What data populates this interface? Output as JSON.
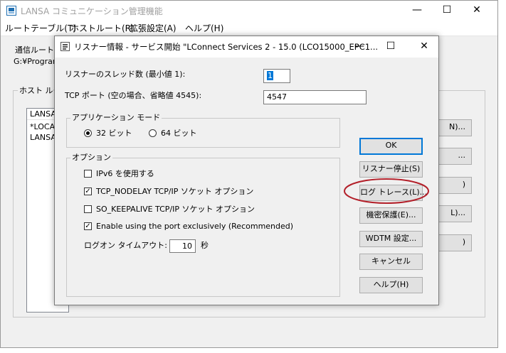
{
  "main_window": {
    "title": "LANSA コミュニケーション管理機能",
    "controls": {
      "minimize": "—",
      "maximize": "☐",
      "close": "✕"
    },
    "menu": [
      {
        "label": "ルートテーブル(T)"
      },
      {
        "label": "ホストルート(R)"
      },
      {
        "label": "拡張設定(A)"
      },
      {
        "label": "ヘルプ(H)"
      }
    ],
    "route_label": "通信ルート",
    "path_label": "G:¥Program",
    "host_group_label": "ホスト ルー",
    "list_header": "LANSA",
    "list_items": [
      "*LOCA",
      "LANSA_"
    ],
    "partial_buttons": [
      "N)...",
      "...",
      ")",
      "L)...",
      ")"
    ]
  },
  "dialog": {
    "title": "リスナー情報 - サービス開始 \"LConnect Services 2 - 15.0 (LCO15000_EPC1...",
    "controls": {
      "minimize": "—",
      "maximize": "☐",
      "close": "✕"
    },
    "thread_label": "リスナーのスレッド数 (最小値 1):",
    "thread_value": "1",
    "port_label": "TCP ポート (空の場合、省略値 4545):",
    "port_value": "4547",
    "app_mode": {
      "label": "アプリケーション モード",
      "options": [
        {
          "label": "32 ビット",
          "selected": true
        },
        {
          "label": "64 ビット",
          "selected": false
        }
      ]
    },
    "options": {
      "label": "オプション",
      "items": [
        {
          "label": "IPv6 を使用する",
          "checked": false
        },
        {
          "label": "TCP_NODELAY TCP/IP ソケット オプション",
          "checked": true
        },
        {
          "label": "SO_KEEPALIVE TCP/IP ソケット オプション",
          "checked": false
        },
        {
          "label": "Enable using the port exclusively (Recommended)",
          "checked": true
        }
      ],
      "timeout_label": "ログオン タイムアウト:",
      "timeout_value": "10",
      "timeout_unit": "秒",
      "check_mark": "✓"
    },
    "buttons": {
      "ok": "OK",
      "stop_listener": "リスナー停止(S)",
      "log_trace": "ログ トレース(L)...",
      "security": "機密保護(E)...",
      "wdtm": "WDTM 設定...",
      "cancel": "キャンセル",
      "help": "ヘルプ(H)"
    }
  },
  "colors": {
    "highlight_ellipse": "#b3202a",
    "default_button_border": "#0078d7",
    "app_icon": "#1f6fb2"
  }
}
